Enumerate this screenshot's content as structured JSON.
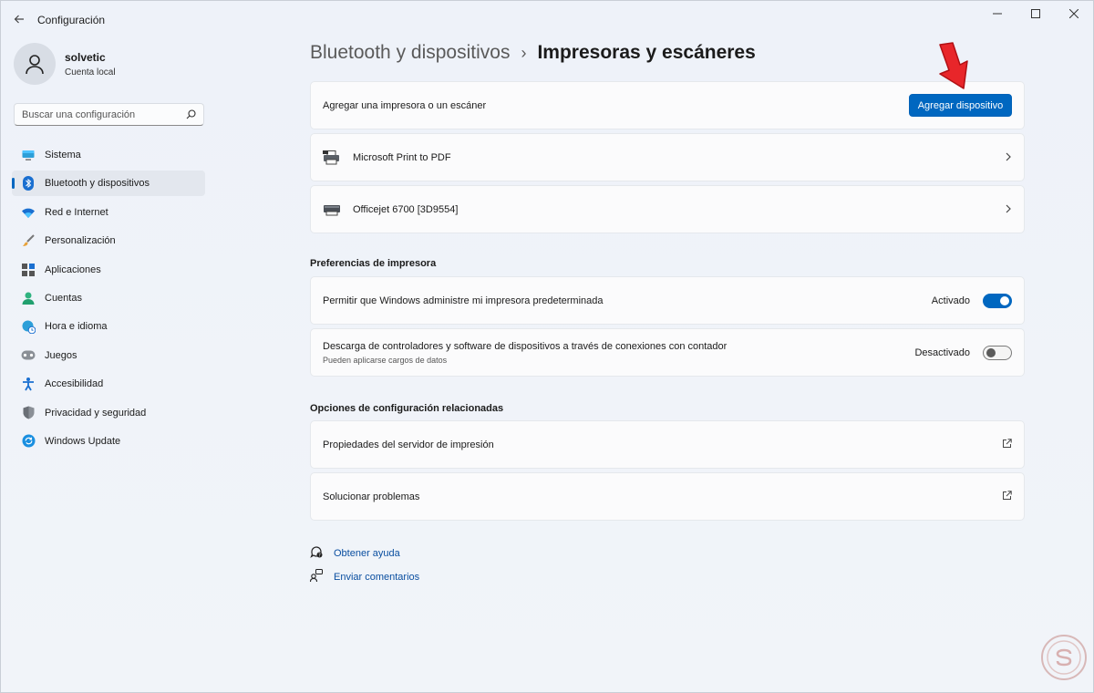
{
  "window": {
    "title": "Configuración",
    "controls": {
      "minimize": "—",
      "maximize": "☐",
      "close": "✕"
    }
  },
  "profile": {
    "name": "solvetic",
    "subtitle": "Cuenta local",
    "icon": "person-icon"
  },
  "search": {
    "placeholder": "Buscar una configuración",
    "value": "",
    "icon": "search-icon"
  },
  "sidebar": {
    "items": [
      {
        "label": "Sistema",
        "icon": "monitor-icon",
        "active": false
      },
      {
        "label": "Bluetooth y dispositivos",
        "icon": "bluetooth-icon",
        "active": true
      },
      {
        "label": "Red e Internet",
        "icon": "wifi-icon",
        "active": false
      },
      {
        "label": "Personalización",
        "icon": "brush-icon",
        "active": false
      },
      {
        "label": "Aplicaciones",
        "icon": "apps-icon",
        "active": false
      },
      {
        "label": "Cuentas",
        "icon": "account-icon",
        "active": false
      },
      {
        "label": "Hora e idioma",
        "icon": "globe-clock-icon",
        "active": false
      },
      {
        "label": "Juegos",
        "icon": "gamepad-icon",
        "active": false
      },
      {
        "label": "Accesibilidad",
        "icon": "accessibility-icon",
        "active": false
      },
      {
        "label": "Privacidad y seguridad",
        "icon": "shield-icon",
        "active": false
      },
      {
        "label": "Windows Update",
        "icon": "update-icon",
        "active": false
      }
    ]
  },
  "breadcrumb": {
    "parent": "Bluetooth y dispositivos",
    "separator": "›",
    "current": "Impresoras y escáneres"
  },
  "add_device": {
    "label": "Agregar una impresora o un escáner",
    "button": "Agregar dispositivo"
  },
  "printers": [
    {
      "name": "Microsoft Print to PDF",
      "icon": "printer-pdf-icon"
    },
    {
      "name": "Officejet 6700 [3D9554]",
      "icon": "printer-icon"
    }
  ],
  "preferences": {
    "title": "Preferencias de impresora",
    "items": [
      {
        "label": "Permitir que Windows administre mi impresora predeterminada",
        "sub": "",
        "state_label": "Activado",
        "on": true
      },
      {
        "label": "Descarga de controladores y software de dispositivos a través de conexiones con contador",
        "sub": "Pueden aplicarse cargos de datos",
        "state_label": "Desactivado",
        "on": false
      }
    ]
  },
  "related": {
    "title": "Opciones de configuración relacionadas",
    "items": [
      {
        "label": "Propiedades del servidor de impresión",
        "icon": "external-link-icon"
      },
      {
        "label": "Solucionar problemas",
        "icon": "external-link-icon"
      }
    ]
  },
  "help": [
    {
      "label": "Obtener ayuda",
      "icon": "help-icon"
    },
    {
      "label": "Enviar comentarios",
      "icon": "feedback-icon"
    }
  ],
  "colors": {
    "accent": "#0067c0",
    "arrow": "#e8262a"
  }
}
